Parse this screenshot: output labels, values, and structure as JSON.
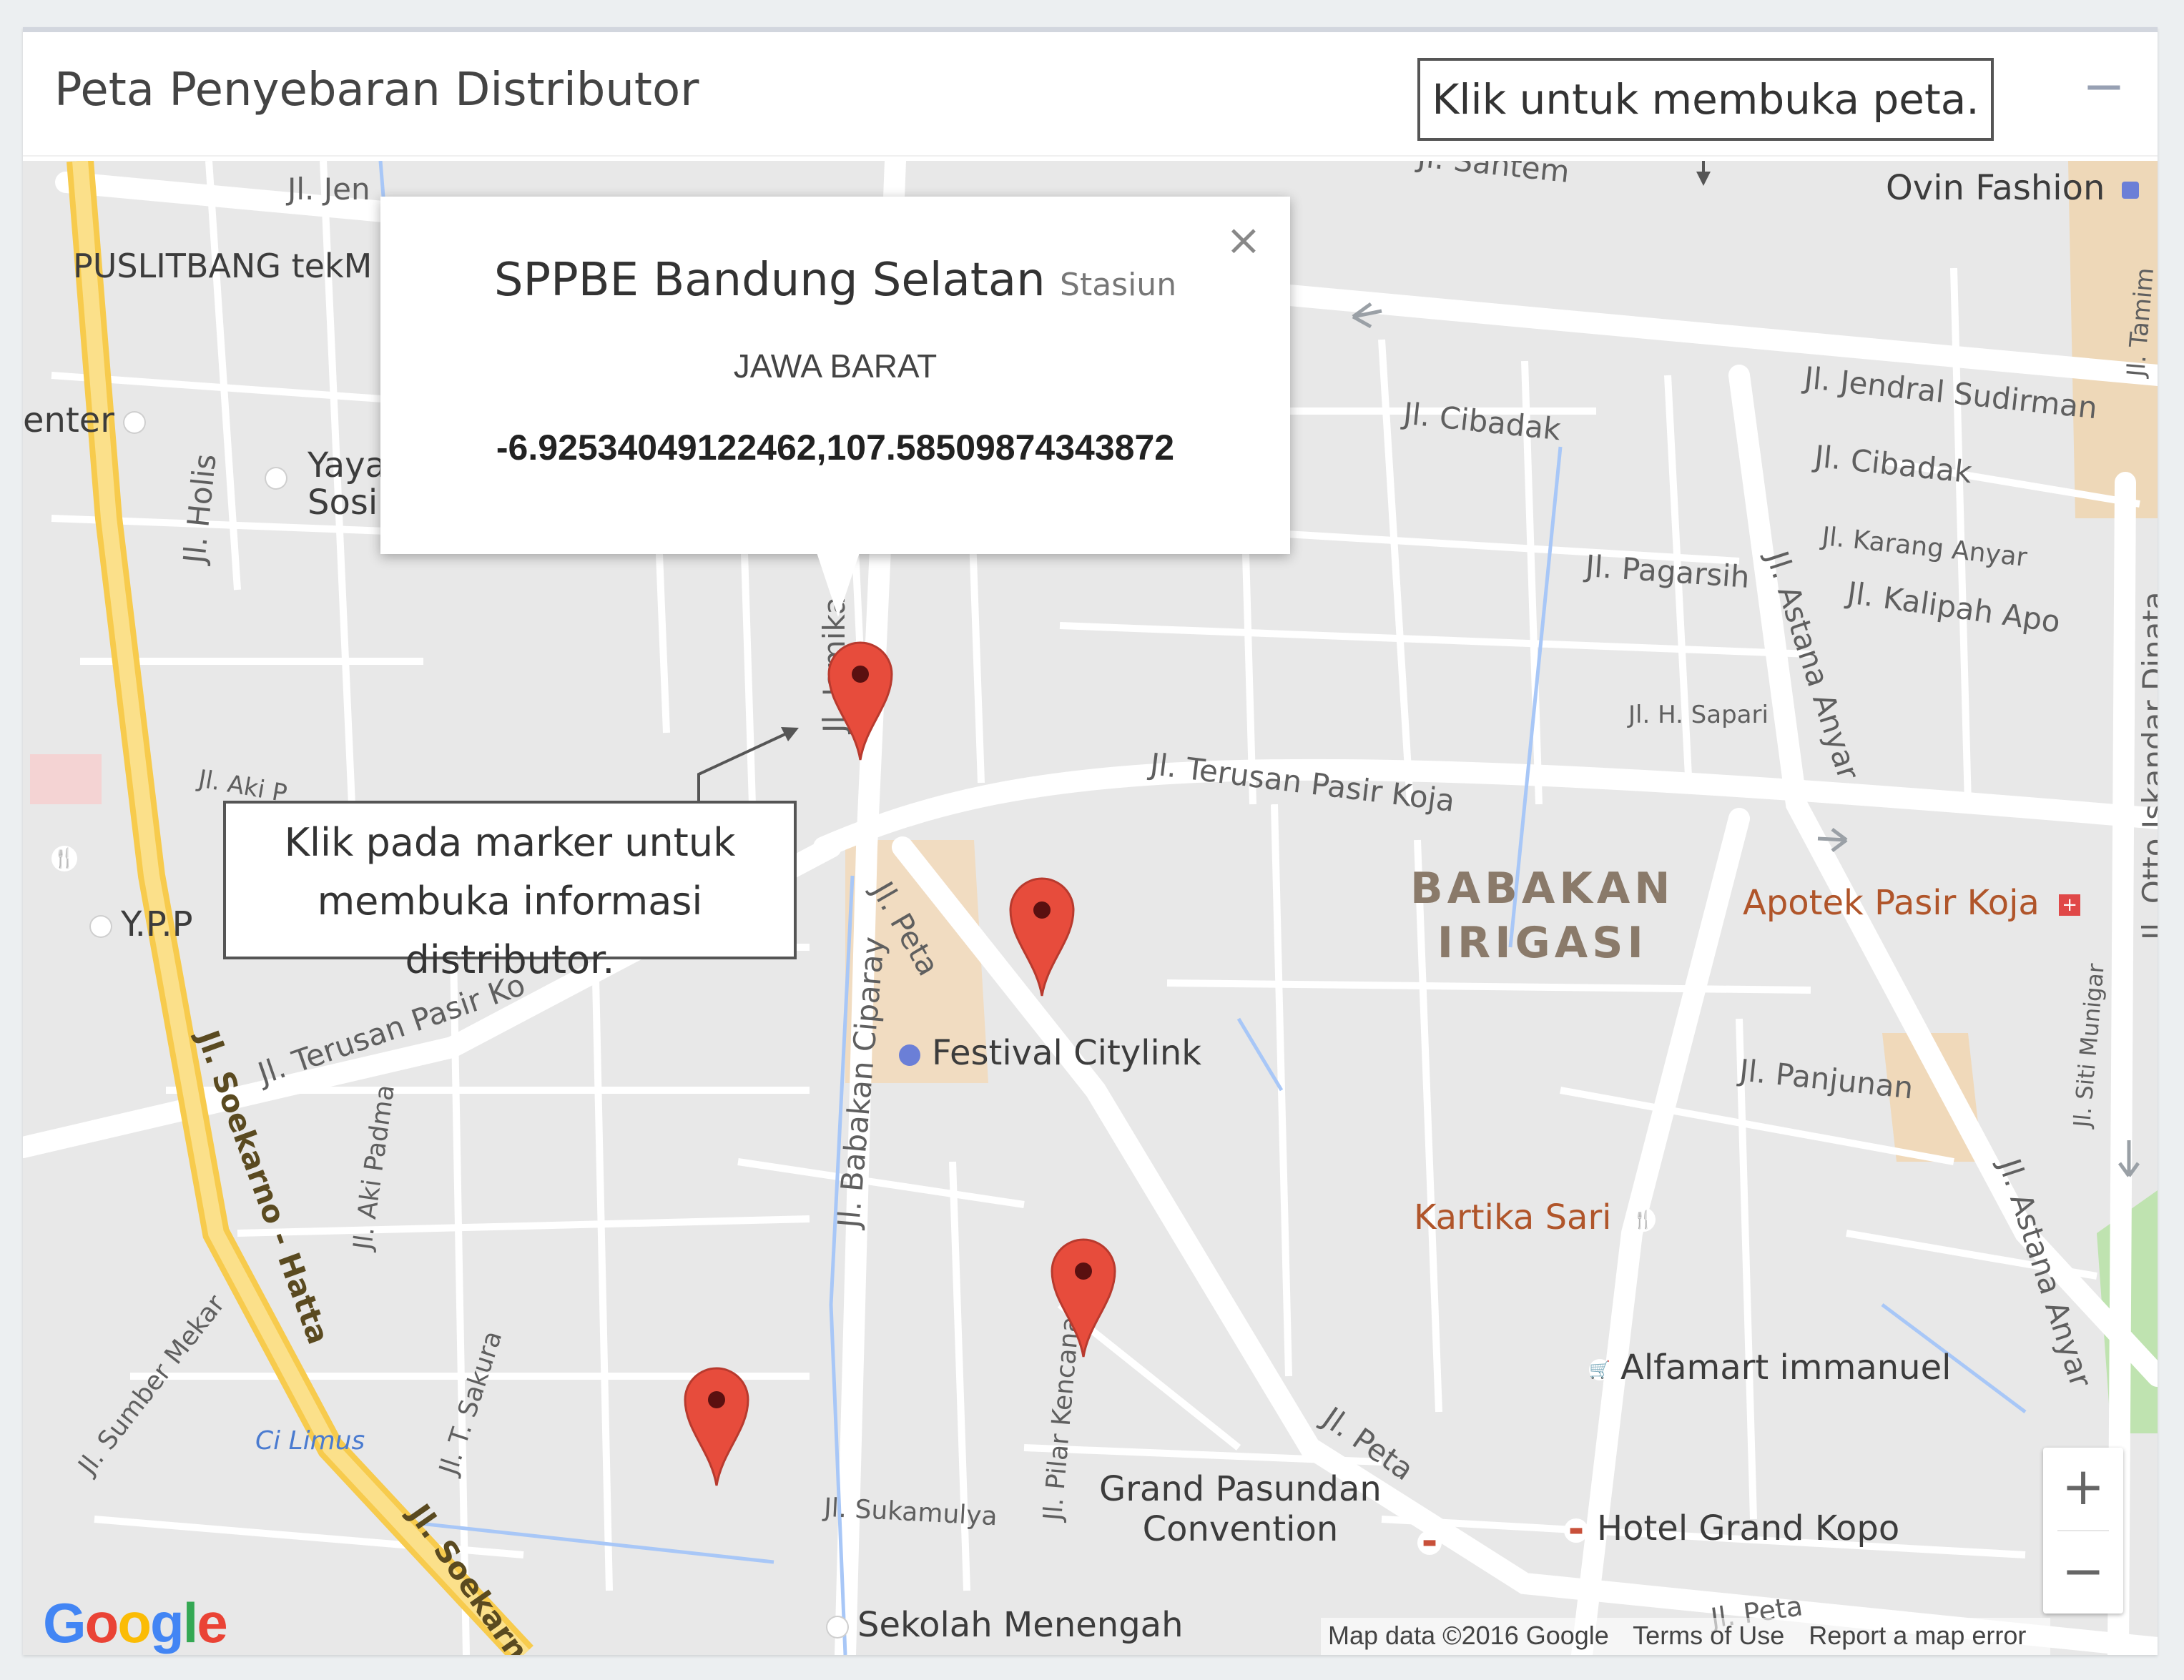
{
  "panel": {
    "title": "Peta Penyebaran Distributor",
    "collapse_label": "−"
  },
  "callouts": {
    "open_map": "Klik untuk membuka peta.",
    "marker_help": [
      "Klik pada marker untuk",
      "membuka informasi",
      "distributor."
    ]
  },
  "infowindow": {
    "title": "SPPBE Bandung Selatan",
    "subtitle": "Stasiun",
    "region": "JAWA BARAT",
    "coordinates": "-6.92534049122462,107.58509874343872",
    "close_label": "×"
  },
  "map": {
    "streets": {
      "jendral_sudirman": "Jl. Jendral Sudirman",
      "cibadak_1": "Jl. Cibadak",
      "cibadak_2": "Jl. Cibadak",
      "karang_anyar": "Jl. Karang Anyar",
      "pagarsih": "Jl. Pagarsih",
      "kalipah_apo": "Jl. Kalipah Apo",
      "h_sapari": "Jl. H. Sapari",
      "terusan_pasir_koja": "Jl. Terusan Pasir Koja",
      "terusan_pasir_left": "Jl. Terusan Pasir Ko",
      "jamika": "Jl. Jamika",
      "peta_1": "Jl. Peta",
      "peta_2": "Jl. Peta",
      "peta_3": "Jl. Peta",
      "babakan_ciparay": "Jl. Babakan Ciparay",
      "panjunan": "Jl. Panjunan",
      "astana_anyar_1": "Jl. Astana Anyar",
      "astana_anyar_2": "Jl. Astana Anyar",
      "otto_iskandar_dinata": "Jl. Otto Iskandar Dinata",
      "tamim": "Jl. Tamim",
      "siti_munigar": "Jl. Siti Munigar",
      "holis": "Jl. Holis",
      "soekarno_hatta": "Jl. Soekarno - Hatta",
      "soekarno_2": "Jl. Soekarn",
      "aki_padma": "Jl. Aki Padma",
      "aki": "Jl. Aki P",
      "sumber_mekar": "Jl. Sumber Mekar",
      "t_sakura": "Jl. T. Sakura",
      "pilar_kencana": "Jl. Pilar Kencana",
      "sukamulya": "Jl. Sukamulya",
      "santem": "Jl. Santem",
      "jen": "Jl. Jen",
      "ci_limus": "Ci Limus"
    },
    "district": [
      "BABAKAN",
      "IRIGASI"
    ],
    "pois": {
      "ovin_fashion": "Ovin Fashion",
      "puslitbang": "PUSLITBANG tekM",
      "center": "enter",
      "yaya": [
        "Yaya",
        "Sosi"
      ],
      "ypp": "Y.P.P",
      "festival_citylink": "Festival Citylink",
      "apotek": "Apotek Pasir Koja",
      "kartika_sari": "Kartika Sari",
      "alfamart": "Alfamart immanuel",
      "grand_pasundan": [
        "Grand Pasundan",
        "Convention"
      ],
      "hotel_grand_kopo": "Hotel Grand Kopo",
      "sekolah": "Sekolah Menengah"
    },
    "zoom_in": "+",
    "zoom_out": "−",
    "logo": [
      "G",
      "o",
      "o",
      "g",
      "l",
      "e"
    ],
    "logo_colors": [
      "#4285f4",
      "#ea4335",
      "#fbbc05",
      "#4285f4",
      "#34a853",
      "#ea4335"
    ],
    "attribution": {
      "map_data": "Map data ©2016 Google",
      "terms": "Terms of Use",
      "report": "Report a map error"
    },
    "marker_color": "#e74c3c"
  }
}
